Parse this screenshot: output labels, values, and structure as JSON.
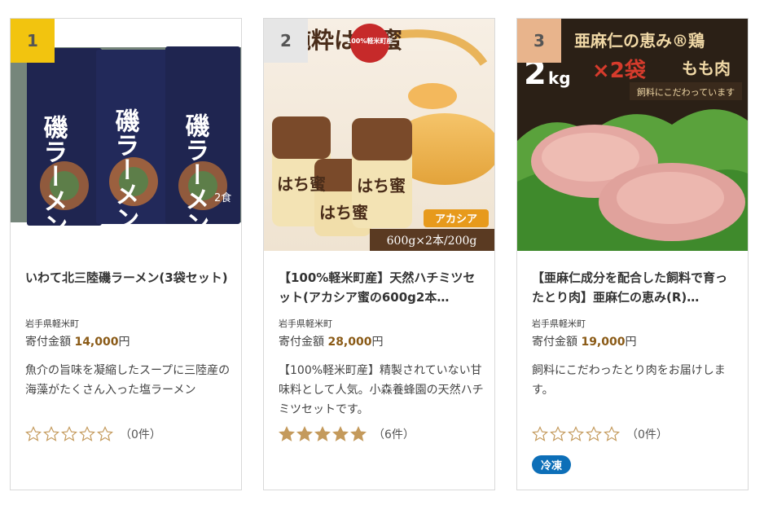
{
  "products": [
    {
      "rank": "1",
      "rank_color": "#f2c40f",
      "image": {
        "pack_text": "磯ラーメン",
        "pack_small": "2食"
      },
      "title": "いわて北三陸磯ラーメン(3袋セット)",
      "town": "岩手県軽米町",
      "amount_label": "寄付金額",
      "amount_value": "14,000",
      "amount_unit": "円",
      "description": "魚介の旨味を凝縮したスープに三陸産の海藻がたくさん入った塩ラーメン",
      "rating": 0,
      "review_count": "（0件）"
    },
    {
      "rank": "2",
      "rank_color": "#e6e6e6",
      "image": {
        "headline": "純粋はち蜜",
        "badge": "100%軽米町産",
        "jar_label": "はち蜜",
        "variety": "アカシア",
        "size": "600g×2本/200g"
      },
      "title": "【100%軽米町産】天然ハチミツセット(アカシア蜜の600g2本…",
      "town": "岩手県軽米町",
      "amount_label": "寄付金額",
      "amount_value": "28,000",
      "amount_unit": "円",
      "description": "【100%軽米町産】精製されていない甘味料として人気。小森養蜂園の天然ハチミツセットです。",
      "rating": 5,
      "review_count": "（6件）"
    },
    {
      "rank": "3",
      "rank_color": "#e8b48c",
      "image": {
        "headline": "亜麻仁の恵み®鶏",
        "weight_unit": "kg",
        "weight_num": "2",
        "qty": "×2袋",
        "cut": "もも肉",
        "tagline": "飼料にこだわっています"
      },
      "title": "【亜麻仁成分を配合した飼料で育ったとり肉】亜麻仁の恵み(R)…",
      "town": "岩手県軽米町",
      "amount_label": "寄付金額",
      "amount_value": "19,000",
      "amount_unit": "円",
      "description": "飼料にこだわったとり肉をお届けします。",
      "rating": 0,
      "review_count": "（0件）",
      "tag": "冷凍"
    }
  ],
  "colors": {
    "star_filled": "#c49a5c",
    "star_empty": "#c49a5c",
    "amount_num": "#8a5a16",
    "tag_bg": "#0d6fb8"
  }
}
